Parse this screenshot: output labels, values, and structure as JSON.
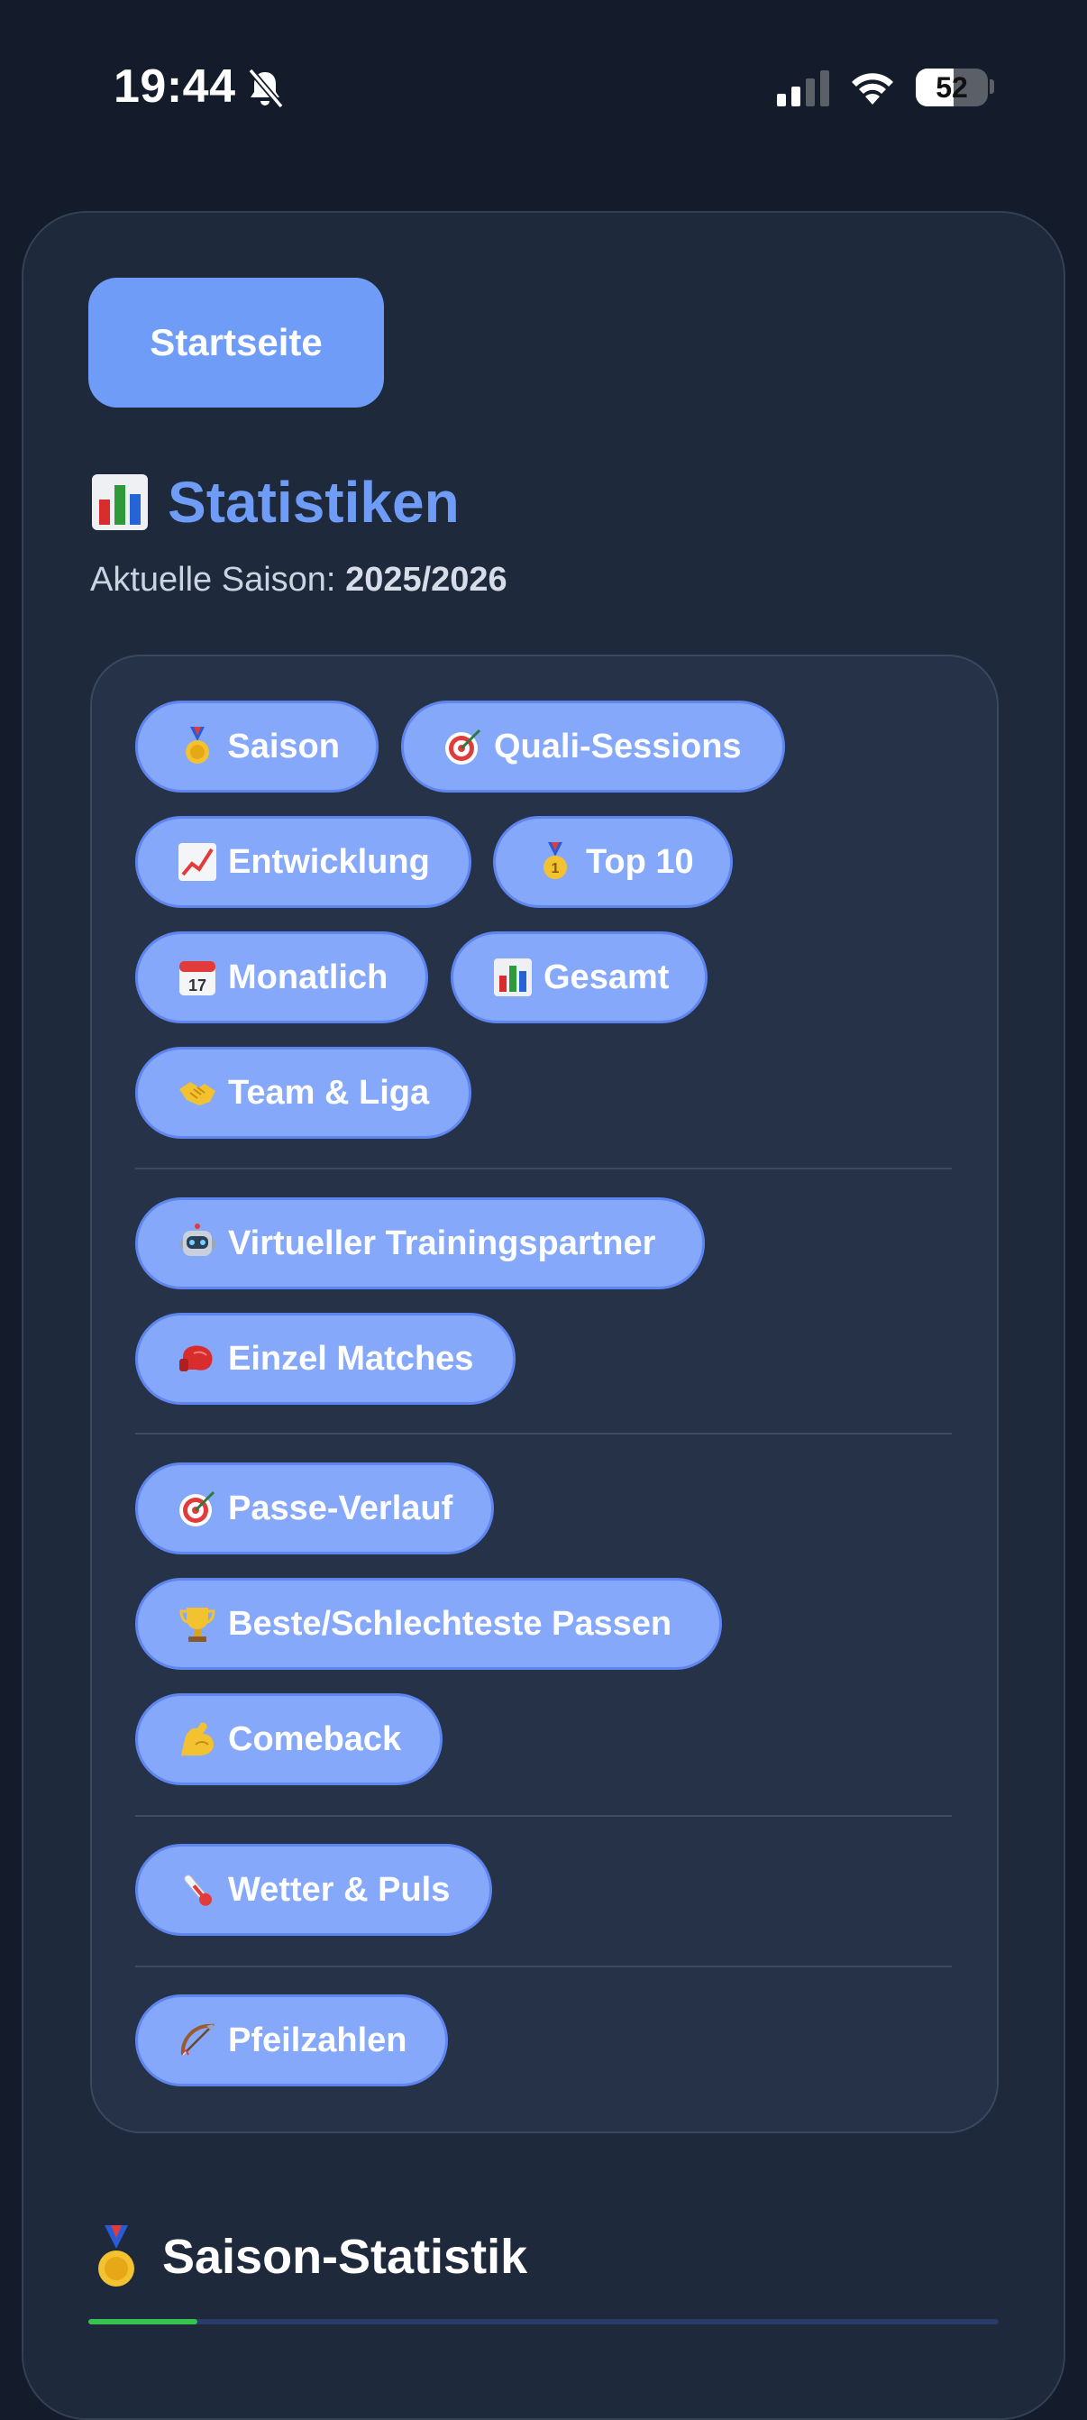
{
  "status_bar": {
    "time": "19:44",
    "battery": "52",
    "battery_level": 0.52
  },
  "home_button": "Startseite",
  "title": "Statistiken",
  "season": {
    "label": "Aktuelle Saison:",
    "value": "2025/2026"
  },
  "nav": {
    "saison": "Saison",
    "quali": "Quali-Sessions",
    "entwicklung": "Entwicklung",
    "top10": "Top 10",
    "monatlich": "Monatlich",
    "gesamt": "Gesamt",
    "team": "Team & Liga",
    "trainingspartner": "Virtueller Trainingspartner",
    "einzel": "Einzel Matches",
    "passe_verlauf": "Passe-Verlauf",
    "beste": "Beste/Schlechteste Passen",
    "comeback": "Comeback",
    "wetter": "Wetter & Puls",
    "pfeilzahlen": "Pfeilzahlen"
  },
  "section": {
    "title": "Saison-Statistik",
    "progress": 0.12
  },
  "colors": {
    "background": "#141b2b",
    "card": "#1e293b",
    "accent": "#6e9cf6",
    "chip": "#86a8fb",
    "progress": "#35c24f"
  }
}
